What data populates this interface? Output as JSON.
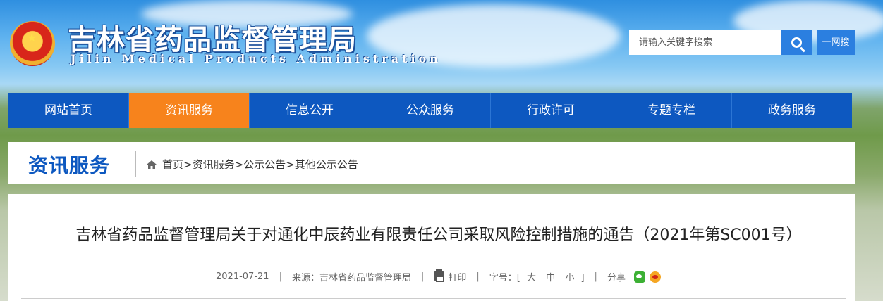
{
  "header": {
    "title": "吉林省药品监督管理局",
    "subtitle": "Jilin Medical Products Administration",
    "search": {
      "placeholder": "请输入关键字搜索"
    },
    "yiwang_label": "一网搜"
  },
  "nav": {
    "items": [
      {
        "label": "网站首页"
      },
      {
        "label": "资讯服务"
      },
      {
        "label": "信息公开"
      },
      {
        "label": "公众服务"
      },
      {
        "label": "行政许可"
      },
      {
        "label": "专题专栏"
      },
      {
        "label": "政务服务"
      }
    ],
    "active_index": 1
  },
  "section": {
    "title": "资讯服务",
    "breadcrumb": "首页>资讯服务>公示公告>其他公示公告"
  },
  "article": {
    "title": "吉林省药品监督管理局关于对通化中辰药业有限责任公司采取风险控制措施的通告（2021年第SC001号）",
    "date": "2021-07-21",
    "source_label": "来源：",
    "source": "吉林省药品监督管理局",
    "print_label": "打印",
    "font_size_label": "字号：[",
    "font_large": "大",
    "font_medium": "中",
    "font_small": "小",
    "font_close": "]",
    "share_label": "分享",
    "separator": "|"
  },
  "colors": {
    "nav_blue": "#0d58c0",
    "nav_active": "#f7831c",
    "search_blue": "#2b7fe0"
  }
}
